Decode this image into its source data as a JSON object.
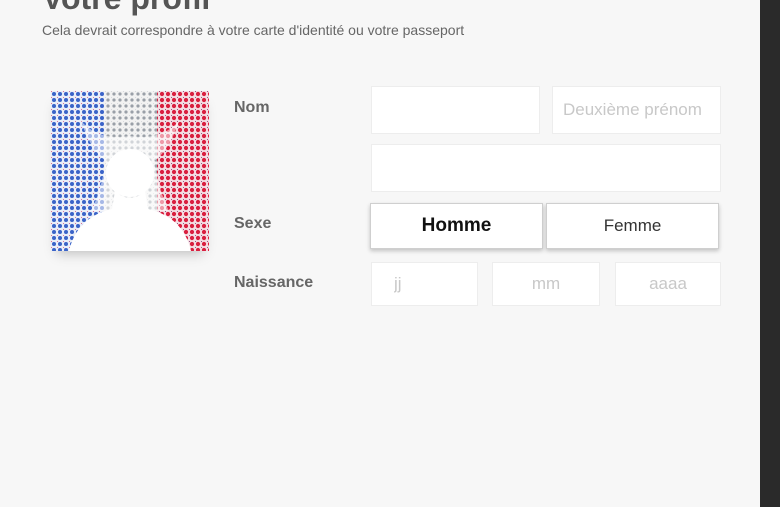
{
  "profile": {
    "title": "Votre profil",
    "subtitle": "Cela devrait correspondre à votre carte d'identité ou votre passeport"
  },
  "form": {
    "nom_label": "Nom",
    "middle_name_placeholder": "Deuxième prénom",
    "sexe_label": "Sexe",
    "homme_label": "Homme",
    "femme_label": "Femme",
    "selected_sexe": "Homme",
    "naissance_label": "Naissance",
    "day_placeholder": "jj",
    "month_placeholder": "mm",
    "year_placeholder": "aaaa"
  },
  "avatar": {
    "icon": "person-silhouette-icon",
    "colors": [
      "#1f4fbf",
      "#ffffff",
      "#e3203a"
    ]
  }
}
